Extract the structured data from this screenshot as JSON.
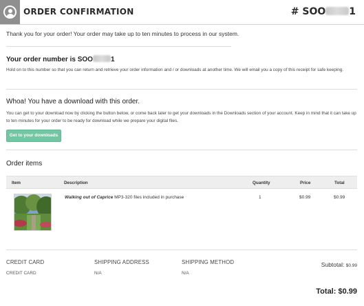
{
  "header": {
    "title": "ORDER CONFIRMATION",
    "order_prefix": "# SOO",
    "order_suffix": "1",
    "icon": "user-circle-icon"
  },
  "thanks_message": "Thank you for your order! Your order may take up to ten minutes to process in our system.",
  "order_number": {
    "label_prefix": "Your order number is SOO",
    "label_suffix": "1",
    "note": "Hold on to this number so that you can return and retrieve your order information and / or downloads at another time. We will email you a copy of this receipt for safe keeping."
  },
  "download": {
    "title": "Whoa! You have a download with this order.",
    "note": "You can get to your download now by clicking the button below, or come back later to get your downloads in the Downloads section of your account. Keep in mind that it can take up to ten minutes for your order to be ready for download while we prepare your digital files.",
    "button_label": "Get to your downloads",
    "button_color": "#74c5a2"
  },
  "items": {
    "title": "Order items",
    "columns": [
      "Item",
      "Description",
      "Quantity",
      "Price",
      "Total"
    ],
    "rows": [
      {
        "title": "Walking out of Caprice",
        "description": " MP3-320 files included in purchase",
        "quantity": "1",
        "price": "$0.99",
        "total": "$0.99"
      }
    ]
  },
  "footer": {
    "credit_card_label": "CREDIT CARD",
    "credit_card_value": "CREDIT CARD",
    "shipping_address_label": "SHIPPING ADDRESS",
    "shipping_address_value": "N/A",
    "shipping_method_label": "SHIPPING METHOD",
    "shipping_method_value": "N/A",
    "subtotal_label": "Subtotal: ",
    "subtotal_value": "$0.99",
    "total_label": "Total: ",
    "total_value": "$0.99"
  }
}
